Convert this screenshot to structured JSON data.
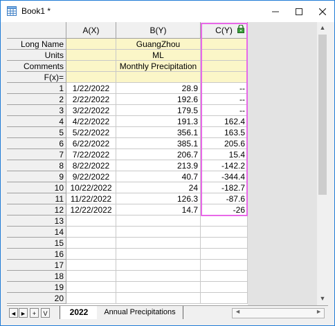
{
  "window": {
    "title": "Book1 *"
  },
  "columns": [
    {
      "header": "A(X)"
    },
    {
      "header": "B(Y)"
    },
    {
      "header": "C(Y)"
    }
  ],
  "meta_rows": [
    {
      "label": "Long Name",
      "a": "",
      "b": "GuangZhou",
      "c": ""
    },
    {
      "label": "Units",
      "a": "",
      "b": "ML",
      "c": ""
    },
    {
      "label": "Comments",
      "a": "",
      "b": "Monthly Precipitation",
      "c": ""
    },
    {
      "label": "F(x)=",
      "a": "",
      "b": "",
      "c": ""
    }
  ],
  "rows": [
    {
      "n": "1",
      "a": "1/22/2022",
      "b": "28.9",
      "c": "--"
    },
    {
      "n": "2",
      "a": "2/22/2022",
      "b": "192.6",
      "c": "--"
    },
    {
      "n": "3",
      "a": "3/22/2022",
      "b": "179.5",
      "c": "--"
    },
    {
      "n": "4",
      "a": "4/22/2022",
      "b": "191.3",
      "c": "162.4"
    },
    {
      "n": "5",
      "a": "5/22/2022",
      "b": "356.1",
      "c": "163.5"
    },
    {
      "n": "6",
      "a": "6/22/2022",
      "b": "385.1",
      "c": "205.6"
    },
    {
      "n": "7",
      "a": "7/22/2022",
      "b": "206.7",
      "c": "15.4"
    },
    {
      "n": "8",
      "a": "8/22/2022",
      "b": "213.9",
      "c": "-142.2"
    },
    {
      "n": "9",
      "a": "9/22/2022",
      "b": "40.7",
      "c": "-344.4"
    },
    {
      "n": "10",
      "a": "10/22/2022",
      "b": "24",
      "c": "-182.7"
    },
    {
      "n": "11",
      "a": "11/22/2022",
      "b": "126.3",
      "c": "-87.6"
    },
    {
      "n": "12",
      "a": "12/22/2022",
      "b": "14.7",
      "c": "-26"
    },
    {
      "n": "13",
      "a": "",
      "b": "",
      "c": ""
    },
    {
      "n": "14",
      "a": "",
      "b": "",
      "c": ""
    },
    {
      "n": "15",
      "a": "",
      "b": "",
      "c": ""
    },
    {
      "n": "16",
      "a": "",
      "b": "",
      "c": ""
    },
    {
      "n": "17",
      "a": "",
      "b": "",
      "c": ""
    },
    {
      "n": "18",
      "a": "",
      "b": "",
      "c": ""
    },
    {
      "n": "19",
      "a": "",
      "b": "",
      "c": ""
    },
    {
      "n": "20",
      "a": "",
      "b": "",
      "c": ""
    }
  ],
  "tabs": [
    {
      "label": "2022",
      "active": true
    },
    {
      "label": "Annual Precipitations",
      "active": false
    }
  ],
  "nav_buttons": [
    "◄",
    "►",
    "+",
    "V"
  ],
  "icons": {
    "app": "workbook-icon",
    "column_lock": "lock-icon",
    "minimize": "minimize-icon",
    "maximize": "maximize-icon",
    "close": "close-icon"
  },
  "colors": {
    "meta_fill": "#fbf6c8",
    "selection_border": "#e868e8",
    "window_border": "#1e7bd6"
  }
}
